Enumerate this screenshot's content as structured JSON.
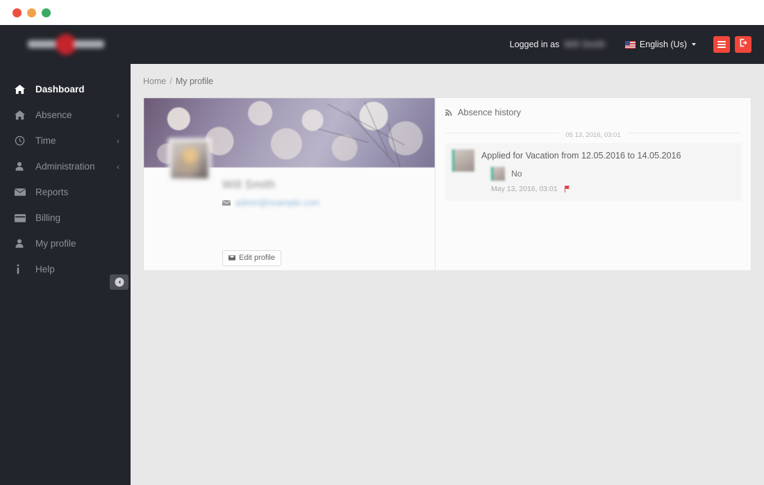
{
  "window": {
    "traffic_lights": [
      "close",
      "minimize",
      "maximize"
    ],
    "colors": {
      "close": "#ee4f40",
      "minimize": "#f0a34b",
      "maximize": "#3aab63",
      "navbar_bg": "#22252b",
      "sidebar_bg": "#22252b",
      "accent_red": "#f2463a",
      "content_bg": "#e8e8e8",
      "card_bg": "#fbfbfb",
      "avatar_accent": "#3fb594",
      "link_blue": "#8fb6d8"
    }
  },
  "navbar": {
    "logo_text": "",
    "logged_in_label": "Logged in as",
    "logged_in_user": "Will Smith",
    "language": {
      "label": "English (Us)",
      "flag": "us-flag-icon",
      "caret": "chevron-down-icon"
    },
    "menu_button": "menu-icon",
    "logout_button": "logout-icon"
  },
  "sidebar": {
    "items": [
      {
        "label": "Dashboard",
        "icon": "home-icon",
        "active": true,
        "arrow": ""
      },
      {
        "label": "Absence",
        "icon": "home-icon",
        "active": false,
        "arrow": "‹"
      },
      {
        "label": "Time",
        "icon": "clock-icon",
        "active": false,
        "arrow": "‹"
      },
      {
        "label": "Administration",
        "icon": "user-icon",
        "active": false,
        "arrow": "‹"
      },
      {
        "label": "Reports",
        "icon": "envelope-icon",
        "active": false,
        "arrow": ""
      },
      {
        "label": "Billing",
        "icon": "credit-card-icon",
        "active": false,
        "arrow": ""
      },
      {
        "label": "My profile",
        "icon": "user-icon",
        "active": false,
        "arrow": ""
      },
      {
        "label": "Help",
        "icon": "info-icon",
        "active": false,
        "arrow": ""
      }
    ],
    "collapse_toggle": "collapse-left-icon"
  },
  "breadcrumb": {
    "home": "Home",
    "separator": "/",
    "current": "My profile"
  },
  "profile": {
    "name": "Will Smith",
    "email": "admin@example.com",
    "email_icon": "envelope-icon",
    "edit_button": {
      "label": "Edit profile",
      "icon": "edit-icon"
    },
    "cover_image": "bokeh-branches-cover-photo",
    "avatar": "user-avatar"
  },
  "absence_history": {
    "title": "Absence history",
    "title_icon": "rss-icon",
    "date_divider": "05 13, 2016, 03:01",
    "entries": [
      {
        "avatar": "user-avatar",
        "text": "Applied for Vacation from 12.05.2016 to 14.05.2016",
        "reply": {
          "avatar": "user-avatar",
          "text": "No"
        },
        "timestamp": "May 13, 2016, 03:01",
        "flag_icon": "red-flag-icon"
      }
    ]
  }
}
